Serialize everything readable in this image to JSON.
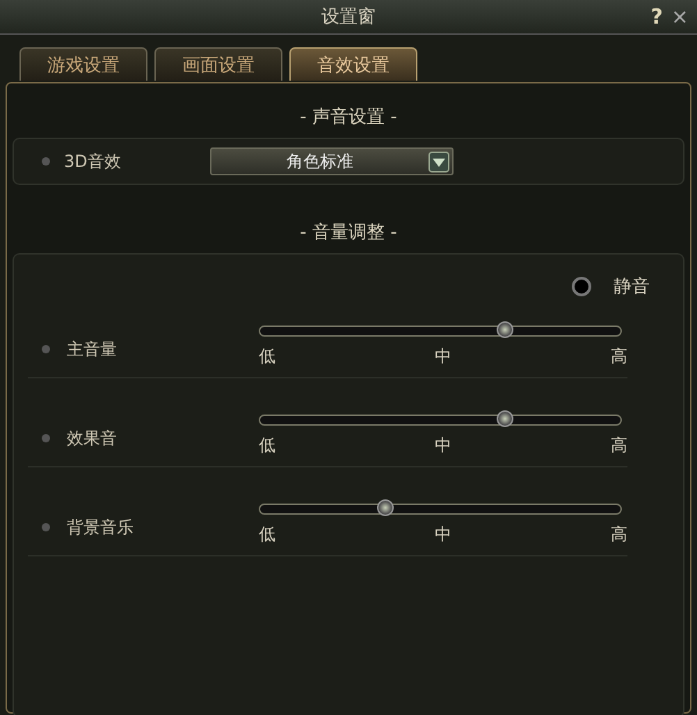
{
  "window": {
    "title": "设置窗",
    "help": "?",
    "close": "×"
  },
  "tabs": [
    {
      "label": "游戏设置",
      "selected": false
    },
    {
      "label": "画面设置",
      "selected": false
    },
    {
      "label": "音效设置",
      "selected": true
    }
  ],
  "sound_section": {
    "heading": "- 声音设置 -",
    "label": "3D音效",
    "dropdown": {
      "value": "角色标准"
    }
  },
  "volume_section": {
    "heading": "- 音量调整 -",
    "mute": {
      "label": "静音",
      "checked": false
    },
    "sliders": [
      {
        "label": "主音量",
        "level": 0.68,
        "ticks": [
          "低",
          "中",
          "高"
        ]
      },
      {
        "label": "效果音",
        "level": 0.68,
        "ticks": [
          "低",
          "中",
          "高"
        ]
      },
      {
        "label": "背景音乐",
        "level": 0.35,
        "ticks": [
          "低",
          "中",
          "高"
        ]
      }
    ]
  }
}
